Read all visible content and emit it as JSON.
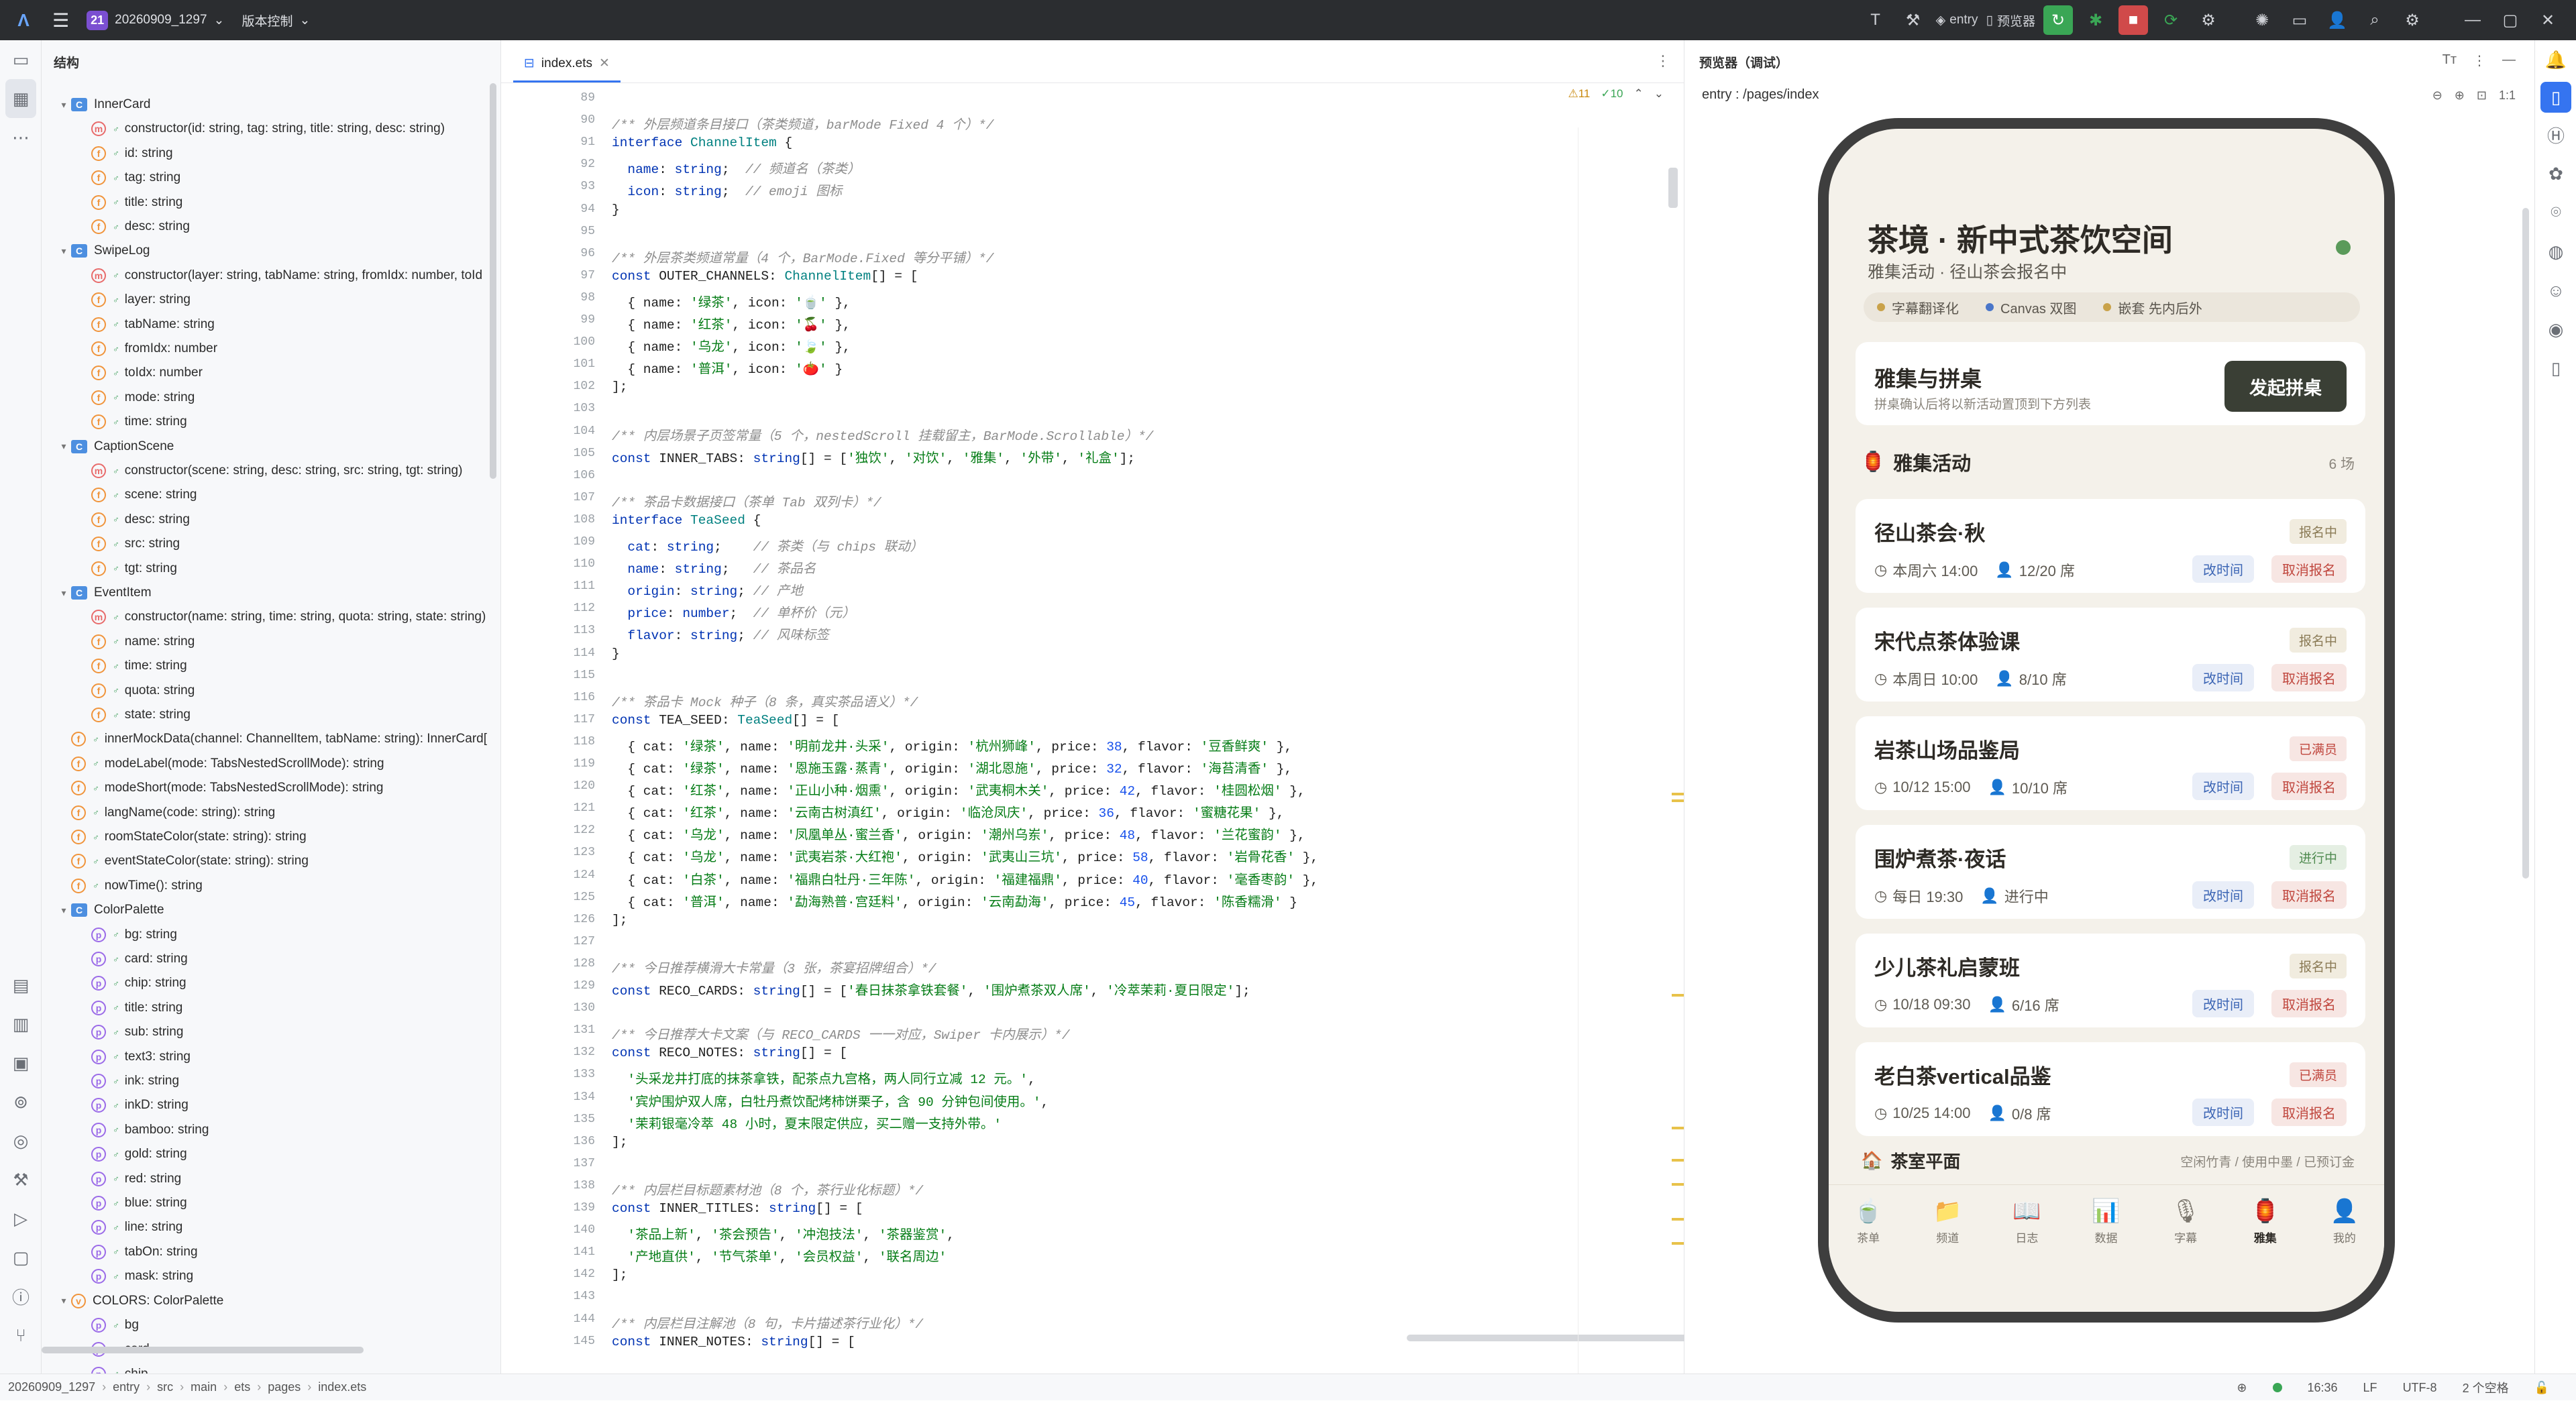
{
  "titlebar": {
    "project_badge": "21",
    "project_name": "20260909_1297",
    "vcs_label": "版本控制",
    "run_config": "entry",
    "device": "预览器"
  },
  "structure": {
    "title": "结构",
    "rows": [
      {
        "indent": 0,
        "arrow": "▾",
        "icon": "class",
        "text": "InnerCard"
      },
      {
        "indent": 1,
        "arrow": "",
        "icon": "ctor",
        "text": "constructor(id: string, tag: string, title: string, desc: string)"
      },
      {
        "indent": 1,
        "arrow": "",
        "icon": "f",
        "text": "id: string"
      },
      {
        "indent": 1,
        "arrow": "",
        "icon": "f",
        "text": "tag: string"
      },
      {
        "indent": 1,
        "arrow": "",
        "icon": "f",
        "text": "title: string"
      },
      {
        "indent": 1,
        "arrow": "",
        "icon": "f",
        "text": "desc: string"
      },
      {
        "indent": 0,
        "arrow": "▾",
        "icon": "class",
        "text": "SwipeLog"
      },
      {
        "indent": 1,
        "arrow": "",
        "icon": "ctor",
        "text": "constructor(layer: string, tabName: string, fromIdx: number, toId"
      },
      {
        "indent": 1,
        "arrow": "",
        "icon": "f",
        "text": "layer: string"
      },
      {
        "indent": 1,
        "arrow": "",
        "icon": "f",
        "text": "tabName: string"
      },
      {
        "indent": 1,
        "arrow": "",
        "icon": "f",
        "text": "fromIdx: number"
      },
      {
        "indent": 1,
        "arrow": "",
        "icon": "f",
        "text": "toIdx: number"
      },
      {
        "indent": 1,
        "arrow": "",
        "icon": "f",
        "text": "mode: string"
      },
      {
        "indent": 1,
        "arrow": "",
        "icon": "f",
        "text": "time: string"
      },
      {
        "indent": 0,
        "arrow": "▾",
        "icon": "class",
        "text": "CaptionScene"
      },
      {
        "indent": 1,
        "arrow": "",
        "icon": "ctor",
        "text": "constructor(scene: string, desc: string, src: string, tgt: string)"
      },
      {
        "indent": 1,
        "arrow": "",
        "icon": "f",
        "text": "scene: string"
      },
      {
        "indent": 1,
        "arrow": "",
        "icon": "f",
        "text": "desc: string"
      },
      {
        "indent": 1,
        "arrow": "",
        "icon": "f",
        "text": "src: string"
      },
      {
        "indent": 1,
        "arrow": "",
        "icon": "f",
        "text": "tgt: string"
      },
      {
        "indent": 0,
        "arrow": "▾",
        "icon": "class",
        "text": "EventItem"
      },
      {
        "indent": 1,
        "arrow": "",
        "icon": "ctor",
        "text": "constructor(name: string, time: string, quota: string, state: string)"
      },
      {
        "indent": 1,
        "arrow": "",
        "icon": "f",
        "text": "name: string"
      },
      {
        "indent": 1,
        "arrow": "",
        "icon": "f",
        "text": "time: string"
      },
      {
        "indent": 1,
        "arrow": "",
        "icon": "f",
        "text": "quota: string"
      },
      {
        "indent": 1,
        "arrow": "",
        "icon": "f",
        "text": "state: string"
      },
      {
        "indent": 0,
        "arrow": "",
        "icon": "f",
        "text": "innerMockData(channel: ChannelItem, tabName: string): InnerCard["
      },
      {
        "indent": 0,
        "arrow": "",
        "icon": "f",
        "text": "modeLabel(mode: TabsNestedScrollMode): string"
      },
      {
        "indent": 0,
        "arrow": "",
        "icon": "f",
        "text": "modeShort(mode: TabsNestedScrollMode): string"
      },
      {
        "indent": 0,
        "arrow": "",
        "icon": "f",
        "text": "langName(code: string): string"
      },
      {
        "indent": 0,
        "arrow": "",
        "icon": "f",
        "text": "roomStateColor(state: string): string"
      },
      {
        "indent": 0,
        "arrow": "",
        "icon": "f",
        "text": "eventStateColor(state: string): string"
      },
      {
        "indent": 0,
        "arrow": "",
        "icon": "f",
        "text": "nowTime(): string"
      },
      {
        "indent": 0,
        "arrow": "▾",
        "icon": "class",
        "text": "ColorPalette"
      },
      {
        "indent": 1,
        "arrow": "",
        "icon": "p",
        "text": "bg: string"
      },
      {
        "indent": 1,
        "arrow": "",
        "icon": "p",
        "text": "card: string"
      },
      {
        "indent": 1,
        "arrow": "",
        "icon": "p",
        "text": "chip: string"
      },
      {
        "indent": 1,
        "arrow": "",
        "icon": "p",
        "text": "title: string"
      },
      {
        "indent": 1,
        "arrow": "",
        "icon": "p",
        "text": "sub: string"
      },
      {
        "indent": 1,
        "arrow": "",
        "icon": "p",
        "text": "text3: string"
      },
      {
        "indent": 1,
        "arrow": "",
        "icon": "p",
        "text": "ink: string"
      },
      {
        "indent": 1,
        "arrow": "",
        "icon": "p",
        "text": "inkD: string"
      },
      {
        "indent": 1,
        "arrow": "",
        "icon": "p",
        "text": "bamboo: string"
      },
      {
        "indent": 1,
        "arrow": "",
        "icon": "p",
        "text": "gold: string"
      },
      {
        "indent": 1,
        "arrow": "",
        "icon": "p",
        "text": "red: string"
      },
      {
        "indent": 1,
        "arrow": "",
        "icon": "p",
        "text": "blue: string"
      },
      {
        "indent": 1,
        "arrow": "",
        "icon": "p",
        "text": "line: string"
      },
      {
        "indent": 1,
        "arrow": "",
        "icon": "p",
        "text": "tabOn: string"
      },
      {
        "indent": 1,
        "arrow": "",
        "icon": "p",
        "text": "mask: string"
      },
      {
        "indent": 0,
        "arrow": "▾",
        "icon": "var",
        "text": "COLORS: ColorPalette"
      },
      {
        "indent": 1,
        "arrow": "",
        "icon": "p",
        "text": "bg"
      },
      {
        "indent": 1,
        "arrow": "",
        "icon": "p",
        "text": "card"
      },
      {
        "indent": 1,
        "arrow": "",
        "icon": "p",
        "text": "chip"
      }
    ]
  },
  "editor": {
    "tab_name": "index.ets",
    "warnings": "⚠11",
    "checks": "✓10",
    "lines": [
      {
        "n": "89",
        "html": ""
      },
      {
        "n": "90",
        "html": "<span class='c-com'>/** 外层频道条目接口（茶类频道，barMode Fixed 4 个）*/</span>"
      },
      {
        "n": "91",
        "html": "<span class='c-kw'>interface</span> <span class='c-type'>ChannelItem</span> {"
      },
      {
        "n": "92",
        "html": "  <span class='c-kw'>name</span>: <span class='c-kw'>string</span>;  <span class='c-com'>// 频道名（茶类）</span>"
      },
      {
        "n": "93",
        "html": "  <span class='c-kw'>icon</span>: <span class='c-kw'>string</span>;  <span class='c-com'>// emoji 图标</span>"
      },
      {
        "n": "94",
        "html": "}"
      },
      {
        "n": "95",
        "html": ""
      },
      {
        "n": "96",
        "html": "<span class='c-com'>/** 外层茶类频道常量（4 个，BarMode.Fixed 等分平铺）*/</span>"
      },
      {
        "n": "97",
        "html": "<span class='c-kw'>const</span> OUTER_CHANNELS: <span class='c-type'>ChannelItem</span>[] = ["
      },
      {
        "n": "98",
        "html": "  { name: <span class='c-str'>'绿茶'</span>, icon: <span class='c-str'>'🍵'</span> },"
      },
      {
        "n": "99",
        "html": "  { name: <span class='c-str'>'红茶'</span>, icon: <span class='c-str'>'🍒'</span> },"
      },
      {
        "n": "100",
        "html": "  { name: <span class='c-str'>'乌龙'</span>, icon: <span class='c-str'>'🍃'</span> },"
      },
      {
        "n": "101",
        "html": "  { name: <span class='c-str'>'普洱'</span>, icon: <span class='c-str'>'🍅'</span> }"
      },
      {
        "n": "102",
        "html": "];"
      },
      {
        "n": "103",
        "html": ""
      },
      {
        "n": "104",
        "html": "<span class='c-com'>/** 内层场景子页签常量（5 个，nestedScroll 挂载留主，BarMode.Scrollable）*/</span>"
      },
      {
        "n": "105",
        "html": "<span class='c-kw'>const</span> INNER_TABS: <span class='c-kw'>string</span>[] = [<span class='c-str'>'独饮'</span>, <span class='c-str'>'对饮'</span>, <span class='c-str'>'雅集'</span>, <span class='c-str'>'外带'</span>, <span class='c-str'>'礼盒'</span>];"
      },
      {
        "n": "106",
        "html": ""
      },
      {
        "n": "107",
        "html": "<span class='c-com'>/** 茶品卡数据接口（茶单 Tab 双列卡）*/</span>"
      },
      {
        "n": "108",
        "html": "<span class='c-kw'>interface</span> <span class='c-type'>TeaSeed</span> {"
      },
      {
        "n": "109",
        "html": "  <span class='c-kw'>cat</span>: <span class='c-kw'>string</span>;    <span class='c-com'>// 茶类（与 chips 联动）</span>"
      },
      {
        "n": "110",
        "html": "  <span class='c-kw'>name</span>: <span class='c-kw'>string</span>;   <span class='c-com'>// 茶品名</span>"
      },
      {
        "n": "111",
        "html": "  <span class='c-kw'>origin</span>: <span class='c-kw'>string</span>; <span class='c-com'>// 产地</span>"
      },
      {
        "n": "112",
        "html": "  <span class='c-kw'>price</span>: <span class='c-kw'>number</span>;  <span class='c-com'>// 单杯价（元）</span>"
      },
      {
        "n": "113",
        "html": "  <span class='c-kw'>flavor</span>: <span class='c-kw'>string</span>; <span class='c-com'>// 风味标签</span>"
      },
      {
        "n": "114",
        "html": "}"
      },
      {
        "n": "115",
        "html": ""
      },
      {
        "n": "116",
        "html": "<span class='c-com'>/** 茶品卡 Mock 种子（8 条，真实茶品语义）*/</span>"
      },
      {
        "n": "117",
        "html": "<span class='c-kw'>const</span> TEA_SEED: <span class='c-type'>TeaSeed</span>[] = ["
      },
      {
        "n": "118",
        "html": "  { cat: <span class='c-str'>'绿茶'</span>, name: <span class='c-str'>'明前龙井·头采'</span>, origin: <span class='c-str'>'杭州狮峰'</span>, price: <span class='c-num'>38</span>, flavor: <span class='c-str'>'豆香鲜爽'</span> },"
      },
      {
        "n": "119",
        "html": "  { cat: <span class='c-str'>'绿茶'</span>, name: <span class='c-str'>'恩施玉露·蒸青'</span>, origin: <span class='c-str'>'湖北恩施'</span>, price: <span class='c-num'>32</span>, flavor: <span class='c-str'>'海苔清香'</span> },"
      },
      {
        "n": "120",
        "html": "  { cat: <span class='c-str'>'红茶'</span>, name: <span class='c-str'>'正山小种·烟熏'</span>, origin: <span class='c-str'>'武夷桐木关'</span>, price: <span class='c-num'>42</span>, flavor: <span class='c-str'>'桂圆松烟'</span> },"
      },
      {
        "n": "121",
        "html": "  { cat: <span class='c-str'>'红茶'</span>, name: <span class='c-str'>'云南古树滇红'</span>, origin: <span class='c-str'>'临沧凤庆'</span>, price: <span class='c-num'>36</span>, flavor: <span class='c-str'>'蜜糖花果'</span> },"
      },
      {
        "n": "122",
        "html": "  { cat: <span class='c-str'>'乌龙'</span>, name: <span class='c-str'>'凤凰单丛·蜜兰香'</span>, origin: <span class='c-str'>'潮州乌岽'</span>, price: <span class='c-num'>48</span>, flavor: <span class='c-str'>'兰花蜜韵'</span> },"
      },
      {
        "n": "123",
        "html": "  { cat: <span class='c-str'>'乌龙'</span>, name: <span class='c-str'>'武夷岩茶·大红袍'</span>, origin: <span class='c-str'>'武夷山三坑'</span>, price: <span class='c-num'>58</span>, flavor: <span class='c-str'>'岩骨花香'</span> },"
      },
      {
        "n": "124",
        "html": "  { cat: <span class='c-str'>'白茶'</span>, name: <span class='c-str'>'福鼎白牡丹·三年陈'</span>, origin: <span class='c-str'>'福建福鼎'</span>, price: <span class='c-num'>40</span>, flavor: <span class='c-str'>'毫香枣韵'</span> },"
      },
      {
        "n": "125",
        "html": "  { cat: <span class='c-str'>'普洱'</span>, name: <span class='c-str'>'勐海熟普·宫廷料'</span>, origin: <span class='c-str'>'云南勐海'</span>, price: <span class='c-num'>45</span>, flavor: <span class='c-str'>'陈香糯滑'</span> }"
      },
      {
        "n": "126",
        "html": "];"
      },
      {
        "n": "127",
        "html": ""
      },
      {
        "n": "128",
        "html": "<span class='c-com'>/** 今日推荐横滑大卡常量（3 张，茶宴招牌组合）*/</span>"
      },
      {
        "n": "129",
        "html": "<span class='c-kw'>const</span> RECO_CARDS: <span class='c-kw'>string</span>[] = [<span class='c-str'>'春日抹茶拿铁套餐'</span>, <span class='c-str'>'围炉煮茶双人席'</span>, <span class='c-str'>'冷萃茉莉·夏日限定'</span>];"
      },
      {
        "n": "130",
        "html": ""
      },
      {
        "n": "131",
        "html": "<span class='c-com'>/** 今日推荐大卡文案（与 RECO_CARDS 一一对应，Swiper 卡内展示）*/</span>"
      },
      {
        "n": "132",
        "html": "<span class='c-kw'>const</span> RECO_NOTES: <span class='c-kw'>string</span>[] = ["
      },
      {
        "n": "133",
        "html": "  <span class='c-str'>'头采龙井打底的抹茶拿铁，配茶点九宫格，两人同行立减 12 元。'</span>,"
      },
      {
        "n": "134",
        "html": "  <span class='c-str'>'宾炉围炉双人席，白牡丹煮饮配烤柿饼栗子，含 90 分钟包间使用。'</span>,"
      },
      {
        "n": "135",
        "html": "  <span class='c-str'>'茉莉银毫冷萃 48 小时，夏末限定供应，买二赠一支持外带。'</span>"
      },
      {
        "n": "136",
        "html": "];"
      },
      {
        "n": "137",
        "html": ""
      },
      {
        "n": "138",
        "html": "<span class='c-com'>/** 内层栏目标题素材池（8 个，茶行业化标题）*/</span>"
      },
      {
        "n": "139",
        "html": "<span class='c-kw'>const</span> INNER_TITLES: <span class='c-kw'>string</span>[] = ["
      },
      {
        "n": "140",
        "html": "  <span class='c-str'>'茶品上新'</span>, <span class='c-str'>'茶会预告'</span>, <span class='c-str'>'冲泡技法'</span>, <span class='c-str'>'茶器鉴赏'</span>,"
      },
      {
        "n": "141",
        "html": "  <span class='c-str'>'产地直供'</span>, <span class='c-str'>'节气茶单'</span>, <span class='c-str'>'会员权益'</span>, <span class='c-str'>'联名周边'</span>"
      },
      {
        "n": "142",
        "html": "];"
      },
      {
        "n": "143",
        "html": ""
      },
      {
        "n": "144",
        "html": "<span class='c-com'>/** 内层栏目注解池（8 句，卡片描述茶行业化）*/</span>"
      },
      {
        "n": "145",
        "html": "<span class='c-kw'>const</span> INNER_NOTES: <span class='c-kw'>string</span>[] = ["
      }
    ]
  },
  "preview": {
    "title": "预览器（调试）",
    "path": "entry : /pages/index",
    "app": {
      "title": "茶境 · 新中式茶饮空间",
      "subtitle": "雅集活动 · 径山茶会报名中",
      "chips": [
        {
          "label": "字幕翻译化",
          "color": "#c9a24a"
        },
        {
          "label": "Canvas 双图",
          "color": "#4a76c9"
        },
        {
          "label": "嵌套 先内后外",
          "color": "#c9a24a"
        }
      ],
      "join_title": "雅集与拼桌",
      "join_sub": "拼桌确认后将以新活动置顶到下方列表",
      "join_button": "发起拼桌",
      "events_title": "雅集活动",
      "events_count": "6 场",
      "events": [
        {
          "name": "径山茶会·秋",
          "time": "本周六 14:00",
          "quota": "12/20 席",
          "state": "报名中",
          "state_color": "#8a7a55",
          "state_bg": "#f1ecdf"
        },
        {
          "name": "宋代点茶体验课",
          "time": "本周日 10:00",
          "quota": "8/10 席",
          "state": "报名中",
          "state_color": "#8a7a55",
          "state_bg": "#f1ecdf"
        },
        {
          "name": "岩茶山场品鉴局",
          "time": "10/12 15:00",
          "quota": "10/10 席",
          "state": "已满员",
          "state_color": "#c0473e",
          "state_bg": "#f7e6e3"
        },
        {
          "name": "围炉煮茶·夜话",
          "time": "每日 19:30",
          "quota": "进行中",
          "state": "进行中",
          "state_color": "#4f8a4f",
          "state_bg": "#e5efe3"
        },
        {
          "name": "少儿茶礼启蒙班",
          "time": "10/18 09:30",
          "quota": "6/16 席",
          "state": "报名中",
          "state_color": "#8a7a55",
          "state_bg": "#f1ecdf"
        },
        {
          "name": "老白茶vertical品鉴",
          "time": "10/25 14:00",
          "quota": "0/8 席",
          "state": "已满员",
          "state_color": "#c0473e",
          "state_bg": "#f7e6e3"
        }
      ],
      "btn_change": "改时间",
      "btn_cancel": "取消报名",
      "room_title": "茶室平面",
      "room_right": "空闲竹青 / 使用中墨 / 已预订金",
      "tabs": [
        {
          "icon": "🍵",
          "label": "茶单"
        },
        {
          "icon": "📁",
          "label": "频道"
        },
        {
          "icon": "📖",
          "label": "日志"
        },
        {
          "icon": "📊",
          "label": "数据"
        },
        {
          "icon": "🎙",
          "label": "字幕"
        },
        {
          "icon": "🏮",
          "label": "雅集"
        },
        {
          "icon": "👤",
          "label": "我的"
        }
      ]
    }
  },
  "statusbar": {
    "crumbs": [
      "20260909_1297",
      "entry",
      "src",
      "main",
      "ets",
      "pages",
      "index.ets"
    ],
    "time": "16:36",
    "lf": "LF",
    "enc": "UTF-8",
    "indent": "2 个空格"
  }
}
